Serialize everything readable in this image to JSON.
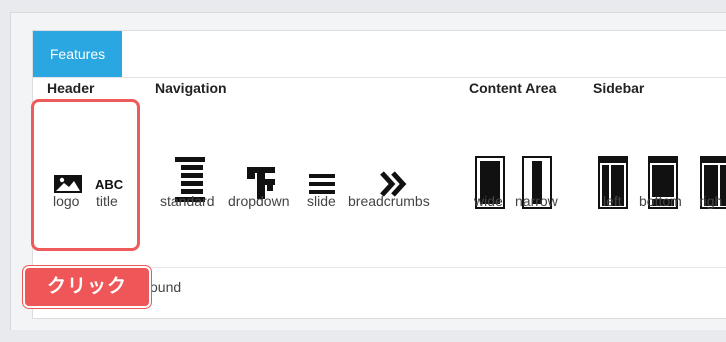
{
  "tab": {
    "label": "Features"
  },
  "sections": {
    "header": {
      "title": "Header",
      "items": [
        "logo",
        "title"
      ],
      "title_glyph": "ABC"
    },
    "navigation": {
      "title": "Navigation",
      "items": [
        "standard",
        "dropdown",
        "slide",
        "breadcrumbs"
      ]
    },
    "content_area": {
      "title": "Content Area",
      "items": [
        "wide",
        "narrow"
      ]
    },
    "sidebar": {
      "title": "Sidebar",
      "items": [
        "left",
        "bottom",
        "righ"
      ]
    }
  },
  "callout": {
    "label": "クリック"
  },
  "second_row": {
    "partial_label": "ound"
  },
  "colors": {
    "accent": "#2aa7e0",
    "callout": "#ef5658"
  }
}
